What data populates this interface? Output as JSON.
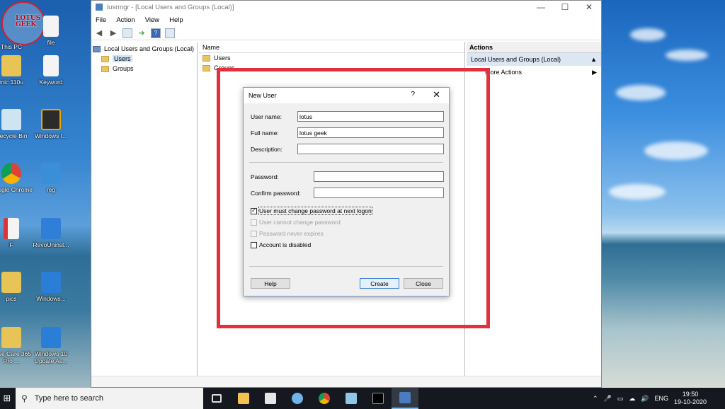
{
  "desktop": {
    "logo_text": "LOTUS\nGEEK",
    "icons": [
      {
        "label": "This PC",
        "icon": "computer-icon"
      },
      {
        "label": "file",
        "icon": "document-icon"
      },
      {
        "label": "mic 110u",
        "icon": "zip-folder-icon"
      },
      {
        "label": "Keyword",
        "icon": "document-icon"
      },
      {
        "label": "Recycle Bin",
        "icon": "recycle-bin-icon"
      },
      {
        "label": "Windows I...",
        "icon": "windows-insider-icon"
      },
      {
        "label": "Google Chrome",
        "icon": "chrome-icon"
      },
      {
        "label": "reg",
        "icon": "registry-icon"
      },
      {
        "label": "F",
        "icon": "document-icon"
      },
      {
        "label": "RevoUninst...",
        "icon": "revo-uninstaller-icon"
      },
      {
        "label": "pics",
        "icon": "folder-icon"
      },
      {
        "label": "Windows...",
        "icon": "windows-update-icon"
      },
      {
        "label": "Wise Care 365 Pro ...",
        "icon": "folder-icon"
      },
      {
        "label": "Windows 10 Update As...",
        "icon": "windows-update-icon"
      }
    ]
  },
  "window": {
    "title": "lusrmgr - [Local Users and Groups (Local)]",
    "controls": {
      "minimize": "—",
      "maximize": "☐",
      "close": "✕"
    },
    "menu": [
      "File",
      "Action",
      "View",
      "Help"
    ],
    "tree": {
      "root": "Local Users and Groups (Local)",
      "children": [
        "Users",
        "Groups"
      ]
    },
    "list": {
      "header": "Name",
      "items": [
        "Users",
        "Groups"
      ]
    },
    "actions": {
      "title": "Actions",
      "group": "Local Users and Groups (Local)",
      "items": [
        "More Actions"
      ]
    }
  },
  "dialog": {
    "title": "New User",
    "help_glyph": "?",
    "close_glyph": "✕",
    "fields": {
      "username_label": "User name:",
      "username_value": "lotus",
      "fullname_label": "Full name:",
      "fullname_value": "lotus geek",
      "description_label": "Description:",
      "description_value": "",
      "password_label": "Password:",
      "confirm_label": "Confirm password:"
    },
    "checkboxes": [
      {
        "label": "User must change password at next logon",
        "checked": true,
        "enabled": true
      },
      {
        "label": "User cannot change password",
        "checked": false,
        "enabled": false
      },
      {
        "label": "Password never expires",
        "checked": false,
        "enabled": false
      },
      {
        "label": "Account is disabled",
        "checked": false,
        "enabled": true
      }
    ],
    "buttons": {
      "help": "Help",
      "create": "Create",
      "close": "Close"
    }
  },
  "taskbar": {
    "search_placeholder": "Type here to search",
    "language": "ENG",
    "time": "19:50",
    "date": "19-10-2020"
  },
  "colors": {
    "annotation": "#e2303f",
    "accent": "#3c7fd1"
  }
}
